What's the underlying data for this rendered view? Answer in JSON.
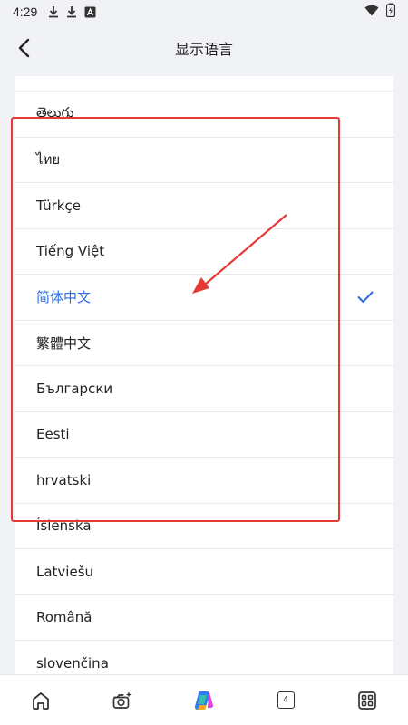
{
  "status_bar": {
    "time": "4:29",
    "left_icons": [
      "download-icon",
      "download-icon",
      "font-icon"
    ],
    "right_icons": [
      "wifi-icon",
      "battery-icon"
    ]
  },
  "header": {
    "title": "显示语言",
    "back_icon": "chevron-left-icon"
  },
  "languages": [
    {
      "label": "తెలుగు",
      "selected": false
    },
    {
      "label": "ไทย",
      "selected": false
    },
    {
      "label": "Türkçe",
      "selected": false
    },
    {
      "label": "Tiếng Việt",
      "selected": false
    },
    {
      "label": "简体中文",
      "selected": true
    },
    {
      "label": "繁體中文",
      "selected": false
    },
    {
      "label": "Български",
      "selected": false
    },
    {
      "label": "Eesti",
      "selected": false
    },
    {
      "label": "hrvatski",
      "selected": false
    },
    {
      "label": "Íslenska",
      "selected": false
    },
    {
      "label": "Latviešu",
      "selected": false
    },
    {
      "label": "Română",
      "selected": false
    },
    {
      "label": "slovenčina",
      "selected": false
    }
  ],
  "bottom_nav": {
    "tabs_count": "4",
    "icons": [
      "home-icon",
      "camera-sparkle-icon",
      "copilot-icon",
      "tabs-icon",
      "apps-grid-icon"
    ]
  },
  "colors": {
    "accent": "#2b6de3",
    "annotation": "#e53935",
    "background": "#f1f2f6"
  }
}
